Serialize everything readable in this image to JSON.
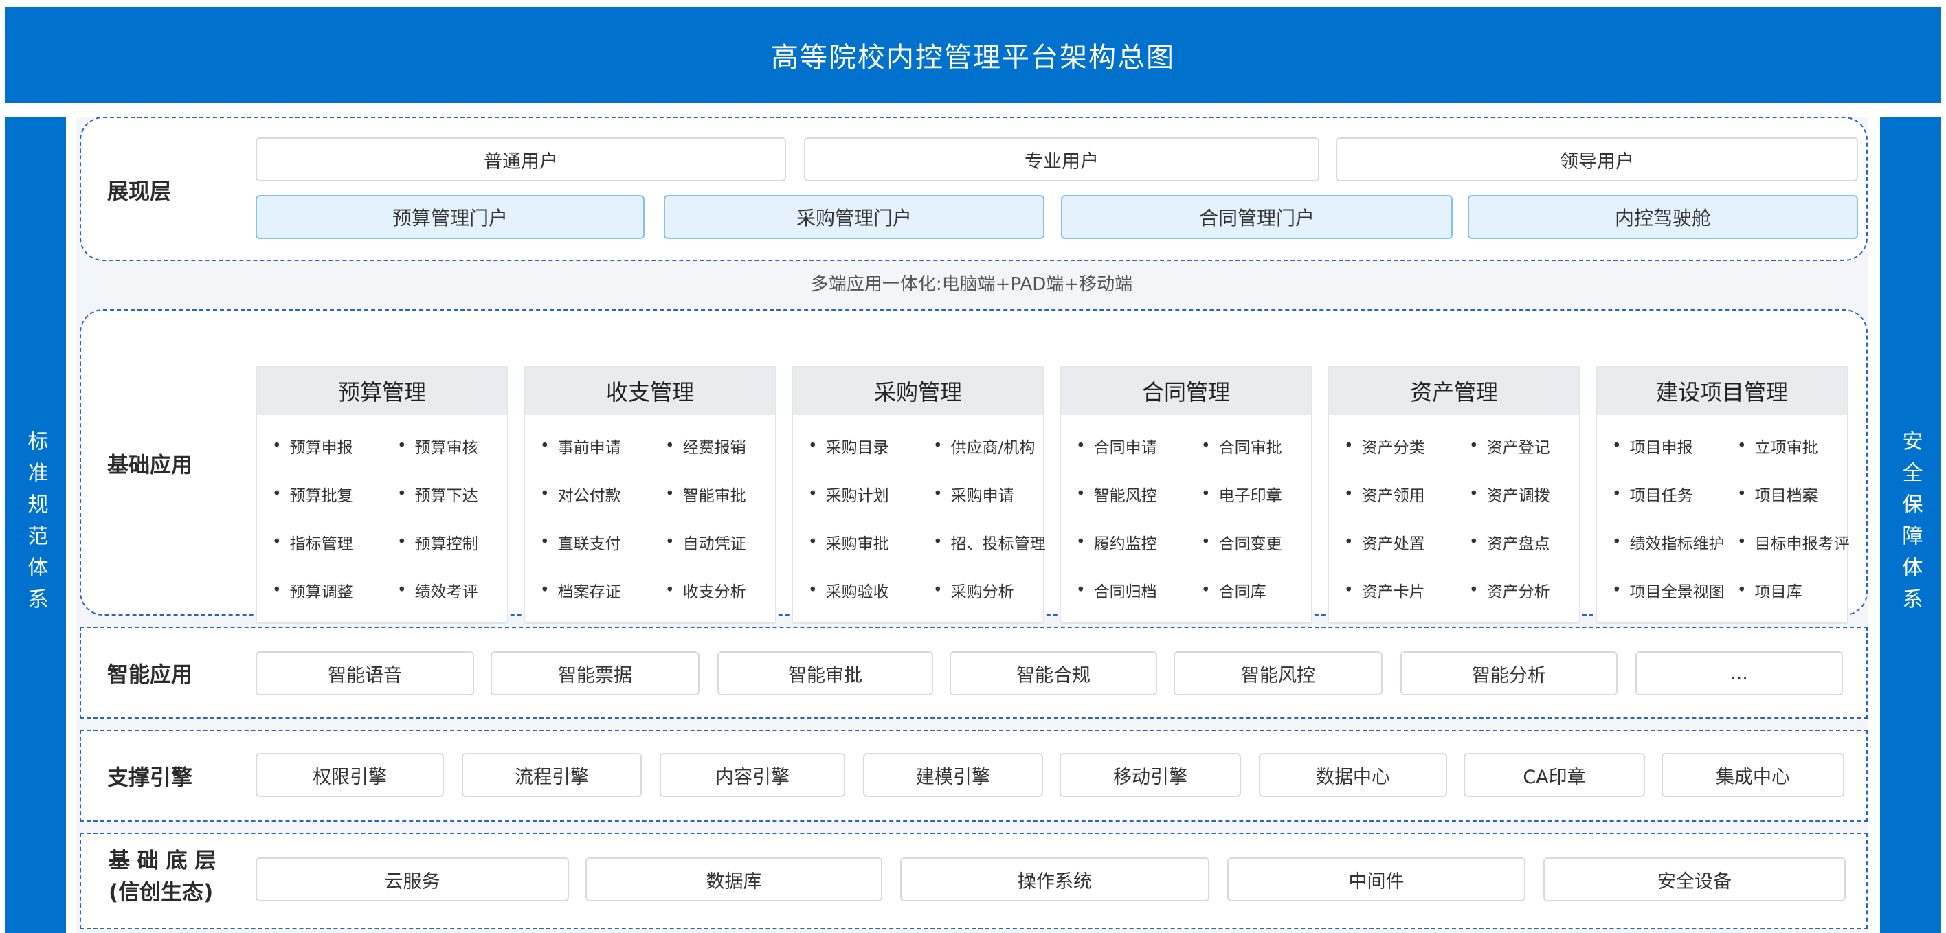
{
  "title": "高等院校内控管理平台架构总图",
  "left_pillar": "标准规范体系",
  "right_pillar": "安全保障体系",
  "presentation": {
    "label": "展现层",
    "users": [
      "普通用户",
      "专业用户",
      "领导用户"
    ],
    "portals": [
      "预算管理门户",
      "采购管理门户",
      "合同管理门户",
      "内控驾驶舱"
    ]
  },
  "multi_terminal_caption": "多端应用一体化:电脑端+PAD端+移动端",
  "basic_apps": {
    "label": "基础应用",
    "modules": [
      {
        "title": "预算管理",
        "items": [
          "预算申报",
          "预算审核",
          "预算批复",
          "预算下达",
          "指标管理",
          "预算控制",
          "预算调整",
          "绩效考评"
        ]
      },
      {
        "title": "收支管理",
        "items": [
          "事前申请",
          "经费报销",
          "对公付款",
          "智能审批",
          "直联支付",
          "自动凭证",
          "档案存证",
          "收支分析"
        ]
      },
      {
        "title": "采购管理",
        "items": [
          "采购目录",
          "供应商/机构",
          "采购计划",
          "采购申请",
          "采购审批",
          "招、投标管理",
          "采购验收",
          "采购分析"
        ]
      },
      {
        "title": "合同管理",
        "items": [
          "合同申请",
          "合同审批",
          "智能风控",
          "电子印章",
          "履约监控",
          "合同变更",
          "合同归档",
          "合同库"
        ]
      },
      {
        "title": "资产管理",
        "items": [
          "资产分类",
          "资产登记",
          "资产领用",
          "资产调拨",
          "资产处置",
          "资产盘点",
          "资产卡片",
          "资产分析"
        ]
      },
      {
        "title": "建设项目管理",
        "items": [
          "项目申报",
          "立项审批",
          "项目任务",
          "项目档案",
          "绩效指标维护",
          "目标申报考评",
          "项目全景视图",
          "项目库"
        ]
      }
    ]
  },
  "smart_apps": {
    "label": "智能应用",
    "items": [
      "智能语音",
      "智能票据",
      "智能审批",
      "智能合规",
      "智能风控",
      "智能分析",
      "..."
    ]
  },
  "engines": {
    "label": "支撑引擎",
    "items": [
      "权限引擎",
      "流程引擎",
      "内容引擎",
      "建模引擎",
      "移动引擎",
      "数据中心",
      "CA印章",
      "集成中心"
    ]
  },
  "infrastructure": {
    "label_line1": "基 础 底 层",
    "label_line2": "(信创生态)",
    "items": [
      "云服务",
      "数据库",
      "操作系统",
      "中间件",
      "安全设备"
    ]
  }
}
